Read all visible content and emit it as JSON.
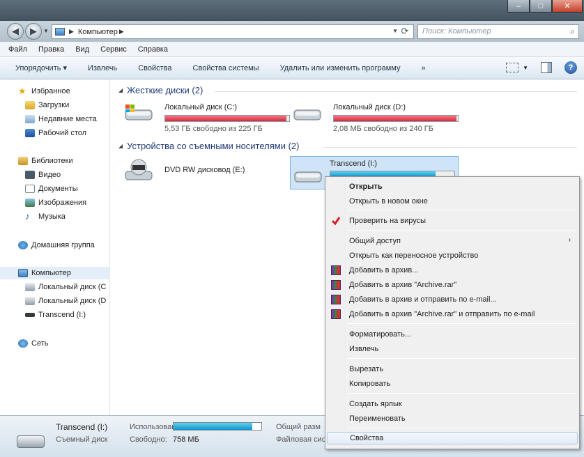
{
  "window": {
    "controls": {
      "minimize": "–",
      "maximize": "□",
      "close": "✕"
    }
  },
  "address": {
    "path": "Компьютер",
    "search_placeholder": "Поиск: Компьютер"
  },
  "menubar": [
    "Файл",
    "Правка",
    "Вид",
    "Сервис",
    "Справка"
  ],
  "commandbar": [
    "Упорядочить ▾",
    "Извлечь",
    "Свойства",
    "Свойства системы",
    "Удалить или изменить программу",
    "»"
  ],
  "navpane": {
    "items": [
      {
        "label": "Избранное",
        "icon": "star-icon",
        "indent": 0
      },
      {
        "label": "Загрузки",
        "icon": "downloads-icon",
        "indent": 1
      },
      {
        "label": "Недавние места",
        "icon": "recent-places-icon",
        "indent": 1
      },
      {
        "label": "Рабочий стол",
        "icon": "desktop-icon",
        "indent": 1
      },
      {
        "label": "Библиотеки",
        "icon": "libraries-icon",
        "indent": 0
      },
      {
        "label": "Видео",
        "icon": "video-icon",
        "indent": 1
      },
      {
        "label": "Документы",
        "icon": "documents-icon",
        "indent": 1
      },
      {
        "label": "Изображения",
        "icon": "pictures-icon",
        "indent": 1
      },
      {
        "label": "Музыка",
        "icon": "music-icon",
        "indent": 1
      },
      {
        "label": "Домашняя группа",
        "icon": "homegroup-icon",
        "indent": 0
      },
      {
        "label": "Компьютер",
        "icon": "computer-icon",
        "indent": 0,
        "selected": true
      },
      {
        "label": "Локальный диск (C",
        "icon": "local-disk-c-icon",
        "indent": 1
      },
      {
        "label": "Локальный диск (D",
        "icon": "local-disk-d-icon",
        "indent": 1
      },
      {
        "label": "Transcend (I:)",
        "icon": "usb-drive-icon",
        "indent": 1
      },
      {
        "label": "Сеть",
        "icon": "network-icon",
        "indent": 0
      }
    ]
  },
  "content": {
    "hard_disks_header": "Жесткие диски (2)",
    "removable_header": "Устройства со съемными носителями (2)",
    "drive_c": {
      "name": "Локальный диск (C:)",
      "free": "5,53 ГБ свободно из 225 ГБ",
      "used_fraction": 0.98
    },
    "drive_d": {
      "name": "Локальный диск (D:)",
      "free": "2,08 МБ свободно из 240 ГБ",
      "used_fraction": 0.99
    },
    "dvd": {
      "name": "DVD RW дисковод (E:)"
    },
    "transcend": {
      "name": "Transcend (I:)",
      "used_fraction": 0.85
    }
  },
  "context_menu": {
    "items": [
      {
        "label": "Открыть",
        "bold": true
      },
      {
        "label": "Открыть в новом окне"
      },
      {
        "label": "Проверить на вирусы",
        "icon": "antivirus-icon"
      },
      {
        "label": "Общий доступ",
        "submenu": "›"
      },
      {
        "label": "Открыть как переносное устройство"
      },
      {
        "label": "Добавить в архив...",
        "icon": "winrar-icon"
      },
      {
        "label": "Добавить в архив \"Archive.rar\"",
        "icon": "winrar-icon"
      },
      {
        "label": "Добавить в архив и отправить по e-mail...",
        "icon": "winrar-icon"
      },
      {
        "label": "Добавить в архив \"Archive.rar\" и отправить по e-mail",
        "icon": "winrar-icon"
      },
      {
        "label": "Форматировать..."
      },
      {
        "label": "Извлечь"
      },
      {
        "label": "Вырезать"
      },
      {
        "label": "Копировать"
      },
      {
        "label": "Создать ярлык"
      },
      {
        "label": "Переименовать"
      },
      {
        "label": "Свойства",
        "highlighted": true
      }
    ]
  },
  "details": {
    "name": "Transcend (I:)",
    "type": "Съемный диск",
    "used_label": "Использовано:",
    "free_label": "Свободно:",
    "free_value": "758 МБ",
    "total_label": "Общий разм",
    "fs_label": "Файловая систе",
    "used_fraction": 0.9
  },
  "colors": {
    "disk_full": "#d9283a",
    "disk_ok": "#1593c9",
    "accent": "#1e3a78"
  }
}
